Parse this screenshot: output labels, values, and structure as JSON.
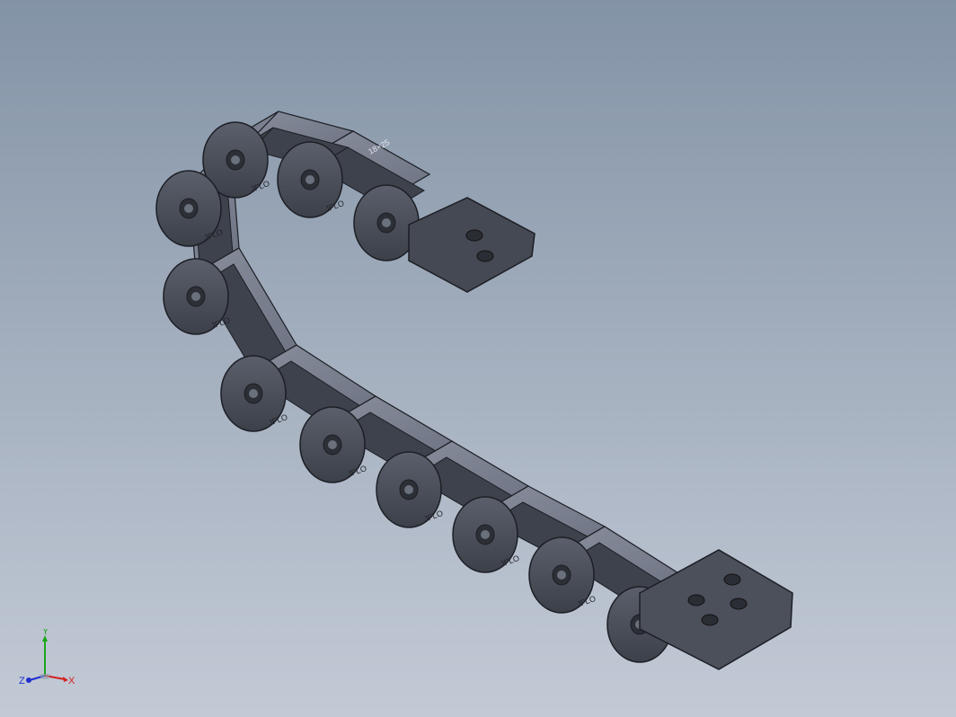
{
  "viewport": {
    "background_top": "#8393a6",
    "background_bottom": "#c3cad6",
    "model": {
      "part_color": "#4a4e59",
      "edge_color": "#1c1e24",
      "cover_color": "#7c8392",
      "logo_text": "JFLO",
      "size_text": "18×25"
    }
  },
  "triad": {
    "x_label": "X",
    "y_label": "Y",
    "z_label": "Z",
    "x_color": "#d32020",
    "y_color": "#1aa51a",
    "z_color": "#1f2fd0"
  }
}
